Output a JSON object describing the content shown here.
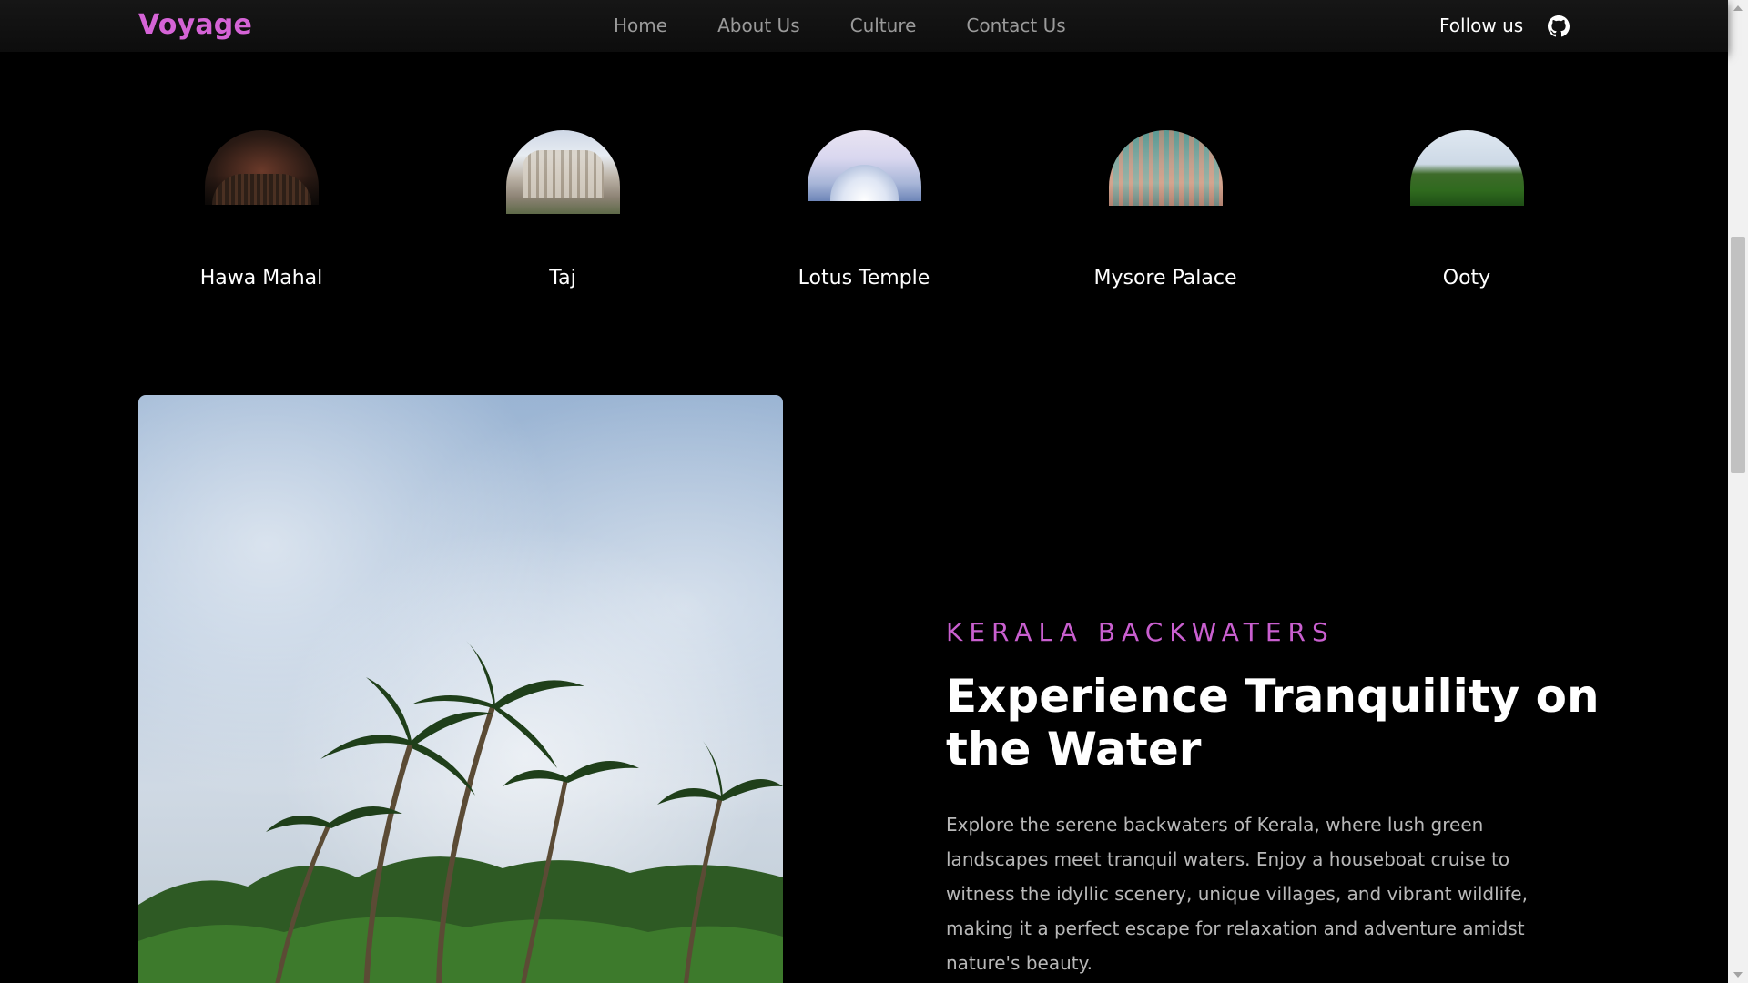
{
  "navbar": {
    "brand": "Voyage",
    "links": [
      "Home",
      "About Us",
      "Culture",
      "Contact Us"
    ],
    "follow_label": "Follow us",
    "social_icon": "github-icon"
  },
  "destinations": [
    {
      "name": "Hawa Mahal"
    },
    {
      "name": "Taj"
    },
    {
      "name": "Lotus Temple"
    },
    {
      "name": "Mysore Palace"
    },
    {
      "name": "Ooty"
    }
  ],
  "feature": {
    "eyebrow": "KERALA BACKWATERS",
    "headline": "Experience Tranquility on the Water",
    "body": "Explore the serene backwaters of Kerala, where lush green landscapes meet tranquil waters. Enjoy a houseboat cruise to witness the idyllic scenery, unique villages, and vibrant wildlife, making it a perfect escape for relaxation and adventure amidst nature's beauty."
  },
  "colors": {
    "brand": "#d563d6",
    "eyebrow": "#c95fcf",
    "background": "#000000"
  }
}
